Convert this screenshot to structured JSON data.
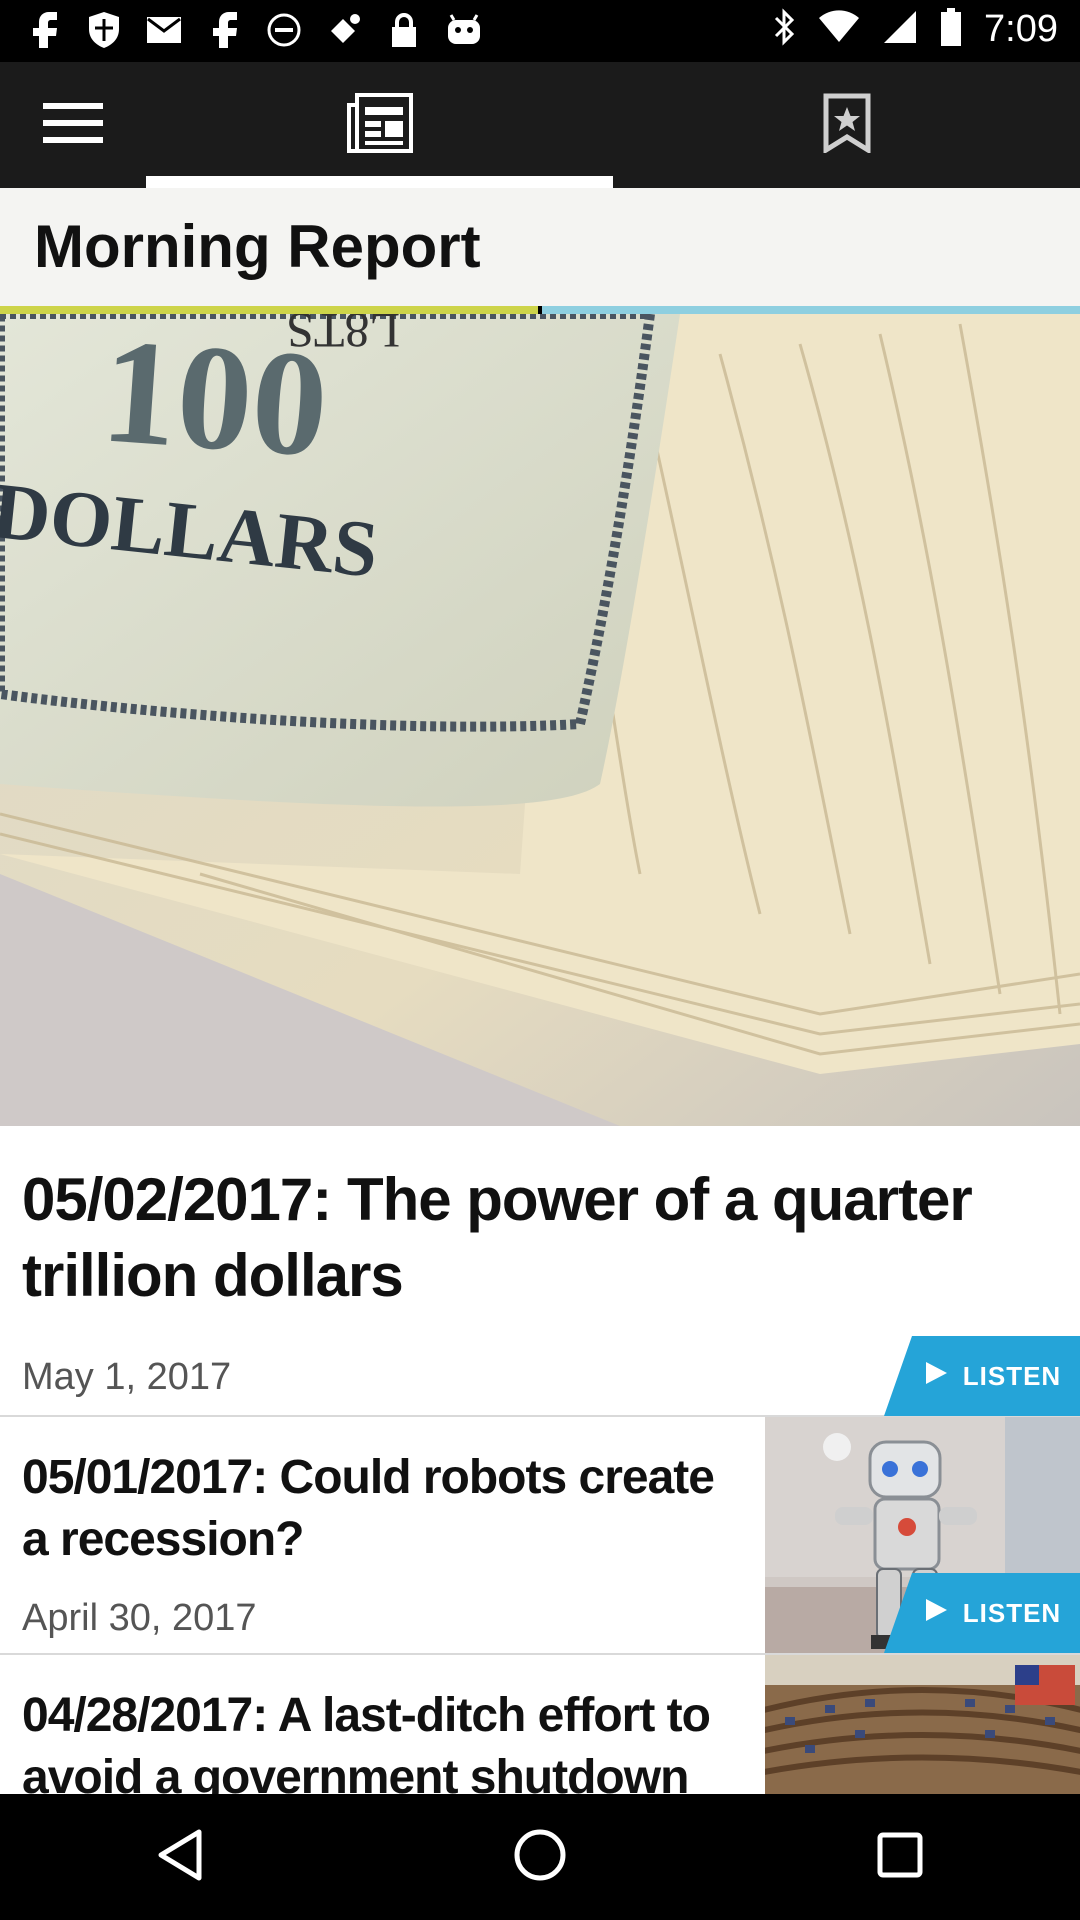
{
  "status_bar": {
    "time": "7:09",
    "left_icons": [
      "facebook-icon",
      "shield-icon",
      "mail-icon",
      "facebook-icon",
      "do-not-disturb-icon",
      "fake-gps-icon",
      "lock-icon",
      "android-icon"
    ],
    "right_icons": [
      "bluetooth-icon",
      "wifi-icon",
      "signal-icon",
      "battery-icon"
    ]
  },
  "toolbar": {
    "items": [
      "menu-icon",
      "news-icon",
      "bookmark-star-icon"
    ],
    "active_index": 1
  },
  "page": {
    "title": "Morning Report",
    "accent_colors": {
      "stripe_left": "#cdd44a",
      "stripe_right": "#8ecfe0",
      "listen": "#25a4d8"
    }
  },
  "featured": {
    "title": "05/02/2017: The power of a quarter trillion dollars",
    "date": "May 1, 2017",
    "listen_label": "LISTEN"
  },
  "articles": [
    {
      "title": "05/01/2017: Could robots create a recession?",
      "date": "April 30, 2017",
      "listen_label": "LISTEN"
    },
    {
      "title": "04/28/2017: A last-ditch effort to avoid a government shutdown"
    }
  ],
  "nav_bar": {
    "items": [
      "back-icon",
      "home-icon",
      "recents-icon"
    ]
  }
}
